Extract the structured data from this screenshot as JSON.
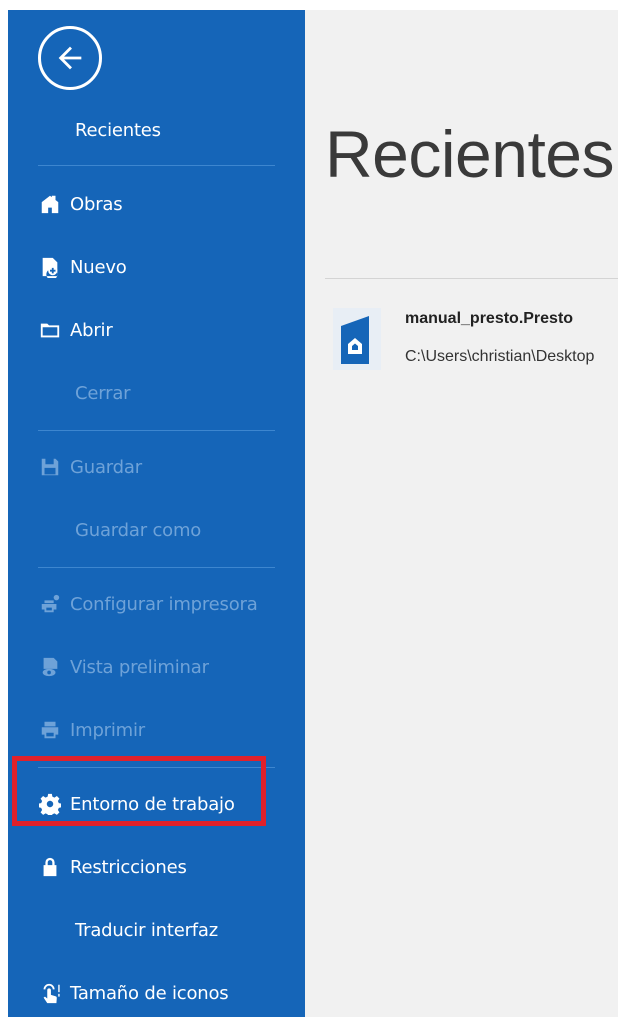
{
  "sidebar": {
    "header_label": "Recientes",
    "items": [
      {
        "label": "Obras",
        "icon": "works-icon",
        "enabled": true
      },
      {
        "label": "Nuevo",
        "icon": "new-file-icon",
        "enabled": true
      },
      {
        "label": "Abrir",
        "icon": "folder-icon",
        "enabled": true
      },
      {
        "label": "Cerrar",
        "icon": "",
        "enabled": false
      },
      {
        "label": "Guardar",
        "icon": "save-icon",
        "enabled": false
      },
      {
        "label": "Guardar como",
        "icon": "",
        "enabled": false
      },
      {
        "label": "Configurar impresora",
        "icon": "printer-settings-icon",
        "enabled": false
      },
      {
        "label": "Vista preliminar",
        "icon": "print-preview-icon",
        "enabled": false
      },
      {
        "label": "Imprimir",
        "icon": "printer-icon",
        "enabled": false
      },
      {
        "label": "Entorno de trabajo",
        "icon": "gear-icon",
        "enabled": true,
        "highlighted": true
      },
      {
        "label": "Restricciones",
        "icon": "lock-icon",
        "enabled": true
      },
      {
        "label": "Traducir interfaz",
        "icon": "",
        "enabled": true
      },
      {
        "label": "Tamaño de iconos",
        "icon": "touch-icon",
        "enabled": true
      }
    ]
  },
  "main": {
    "title": "Recientes",
    "recent_files": [
      {
        "name": "manual_presto.Presto",
        "path": "C:\\Users\\christian\\Desktop"
      }
    ]
  },
  "colors": {
    "sidebar_bg": "#1565b8",
    "disabled_text": "#6ea2d8",
    "highlight_border": "#e0212b",
    "main_bg": "#f1f1f1"
  }
}
